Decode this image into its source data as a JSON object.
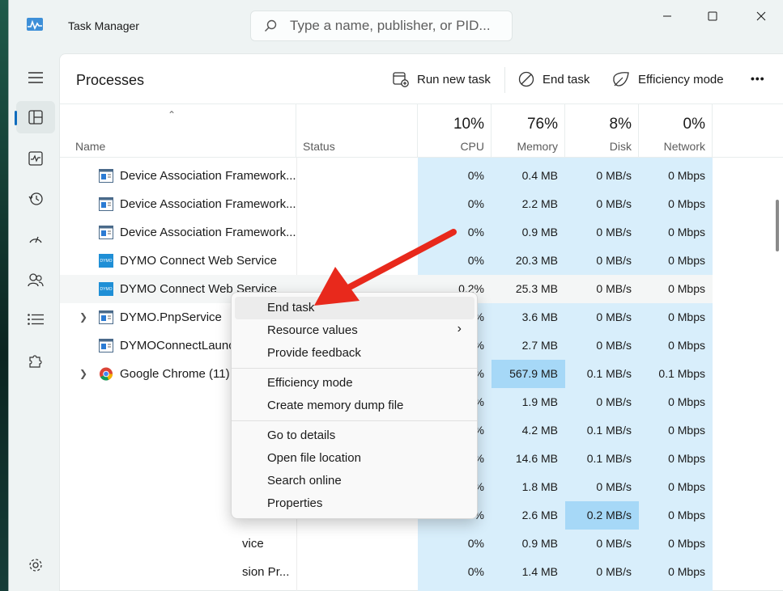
{
  "window": {
    "title": "Task Manager"
  },
  "search": {
    "placeholder": "Type a name, publisher, or PID..."
  },
  "toolbar": {
    "title": "Processes",
    "run_new_task": "Run new task",
    "end_task": "End task",
    "efficiency_mode": "Efficiency mode",
    "more": "•••"
  },
  "table": {
    "headers": {
      "name": "Name",
      "status": "Status",
      "cpu": {
        "label": "CPU",
        "pct": "10%"
      },
      "memory": {
        "label": "Memory",
        "pct": "76%"
      },
      "disk": {
        "label": "Disk",
        "pct": "8%"
      },
      "network": {
        "label": "Network",
        "pct": "0%"
      }
    },
    "rows": [
      {
        "name": "Device Association Framework...",
        "cpu": "0%",
        "memory": "0.4 MB",
        "disk": "0 MB/s",
        "network": "0 Mbps"
      },
      {
        "name": "Device Association Framework...",
        "cpu": "0%",
        "memory": "2.2 MB",
        "disk": "0 MB/s",
        "network": "0 Mbps"
      },
      {
        "name": "Device Association Framework...",
        "cpu": "0%",
        "memory": "0.9 MB",
        "disk": "0 MB/s",
        "network": "0 Mbps"
      },
      {
        "name": "DYMO Connect Web Service",
        "cpu": "0%",
        "memory": "20.3 MB",
        "disk": "0 MB/s",
        "network": "0 Mbps"
      },
      {
        "name": "DYMO Connect Web Service",
        "cpu": "0.2%",
        "memory": "25.3 MB",
        "disk": "0 MB/s",
        "network": "0 Mbps"
      },
      {
        "name": "DYMO.PnpService",
        "cpu": "%",
        "memory": "3.6 MB",
        "disk": "0 MB/s",
        "network": "0 Mbps"
      },
      {
        "name": "DYMOConnectLaunc",
        "cpu": "%",
        "memory": "2.7 MB",
        "disk": "0 MB/s",
        "network": "0 Mbps"
      },
      {
        "name": "Google Chrome (11)",
        "cpu": "%",
        "memory": "567.9 MB",
        "disk": "0.1 MB/s",
        "network": "0.1 Mbps"
      },
      {
        "name": "",
        "cpu": "%",
        "memory": "1.9 MB",
        "disk": "0 MB/s",
        "network": "0 Mbps"
      },
      {
        "name": "",
        "cpu": "%",
        "memory": "4.2 MB",
        "disk": "0.1 MB/s",
        "network": "0 Mbps"
      },
      {
        "name": "",
        "cpu": "%",
        "memory": "14.6 MB",
        "disk": "0.1 MB/s",
        "network": "0 Mbps"
      },
      {
        "name": "",
        "cpu": "%",
        "memory": "1.8 MB",
        "disk": "0 MB/s",
        "network": "0 Mbps"
      },
      {
        "name": "",
        "cpu": "%",
        "memory": "2.6 MB",
        "disk": "0.2 MB/s",
        "network": "0 Mbps"
      },
      {
        "name": "vice",
        "cpu": "0%",
        "memory": "0.9 MB",
        "disk": "0 MB/s",
        "network": "0 Mbps"
      },
      {
        "name": "sion Pr...",
        "cpu": "0%",
        "memory": "1.4 MB",
        "disk": "0 MB/s",
        "network": "0 Mbps"
      }
    ]
  },
  "context_menu": {
    "items": [
      "End task",
      "Resource values",
      "Provide feedback",
      "Efficiency mode",
      "Create memory dump file",
      "Go to details",
      "Open file location",
      "Search online",
      "Properties"
    ],
    "submenu_chevron": "›"
  },
  "colors": {
    "accent": "#0f6cbd",
    "heat_light": "#d8eefb",
    "heat_medium": "#a6d8f7",
    "annotation_arrow": "#e8291c"
  }
}
